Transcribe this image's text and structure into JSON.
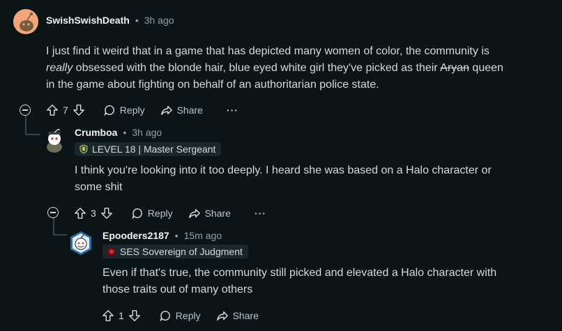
{
  "comments": [
    {
      "author": "SwishSwishDeath",
      "time": "3h ago",
      "body_parts": {
        "p1": "I just find it weird that in a game that has depicted many women of color, the community is",
        "p2_em": "really",
        "p2": " obsessed with the blonde hair, blue eyed white girl they've picked as their ",
        "p2_strike": "Aryan",
        "p2_end": " queen",
        "p3": "in the game about fighting on behalf of an authoritarian police state."
      },
      "votes": "7",
      "reply_label": "Reply",
      "share_label": "Share",
      "more_label": "···"
    },
    {
      "author": "Crumboa",
      "time": "3h ago",
      "flair": "LEVEL 18 | Master Sergeant",
      "body_lines": [
        "I think you're looking into it too deeply. I heard she was based on a Halo character or",
        "some shit"
      ],
      "votes": "3",
      "reply_label": "Reply",
      "share_label": "Share",
      "more_label": "···"
    },
    {
      "author": "Epooders2187",
      "time": "15m ago",
      "flair": "SES Sovereign of Judgment",
      "body_lines": [
        "Even if that's true, the community still picked and elevated a Halo character with",
        "those traits out of many others"
      ],
      "votes": "1",
      "reply_label": "Reply",
      "share_label": "Share"
    }
  ],
  "separator": "•",
  "colors": {
    "background": "#0b1416",
    "text": "#d7dadc",
    "meta": "#8ba2ad",
    "flair_bg": "#1a282d"
  }
}
